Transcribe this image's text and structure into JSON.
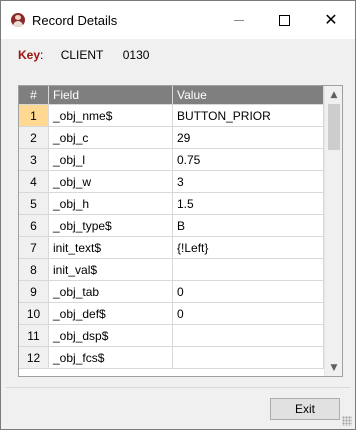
{
  "window": {
    "title": "Record Details",
    "icon": "user-avatar-icon"
  },
  "key": {
    "label": "Key",
    "colon": ":",
    "table": "CLIENT",
    "id": "0130"
  },
  "grid": {
    "columns": [
      "#",
      "Field",
      "Value"
    ],
    "selected_row": 1,
    "rows": [
      {
        "num": "1",
        "field": "_obj_nme$",
        "value": "BUTTON_PRIOR"
      },
      {
        "num": "2",
        "field": "_obj_c",
        "value": "29"
      },
      {
        "num": "3",
        "field": "_obj_l",
        "value": "0.75"
      },
      {
        "num": "4",
        "field": "_obj_w",
        "value": "3"
      },
      {
        "num": "5",
        "field": "_obj_h",
        "value": "1.5"
      },
      {
        "num": "6",
        "field": "_obj_type$",
        "value": "B"
      },
      {
        "num": "7",
        "field": "init_text$",
        "value": "{!Left}"
      },
      {
        "num": "8",
        "field": "init_val$",
        "value": ""
      },
      {
        "num": "9",
        "field": "_obj_tab",
        "value": "0"
      },
      {
        "num": "10",
        "field": "_obj_def$",
        "value": "0"
      },
      {
        "num": "11",
        "field": "_obj_dsp$",
        "value": ""
      },
      {
        "num": "12",
        "field": "_obj_fcs$",
        "value": ""
      }
    ]
  },
  "footer": {
    "exit_label": "Exit"
  },
  "colors": {
    "key_label": "#a01414",
    "header_bg": "#7f7f7f",
    "selected_row_num": "#ffd892"
  }
}
